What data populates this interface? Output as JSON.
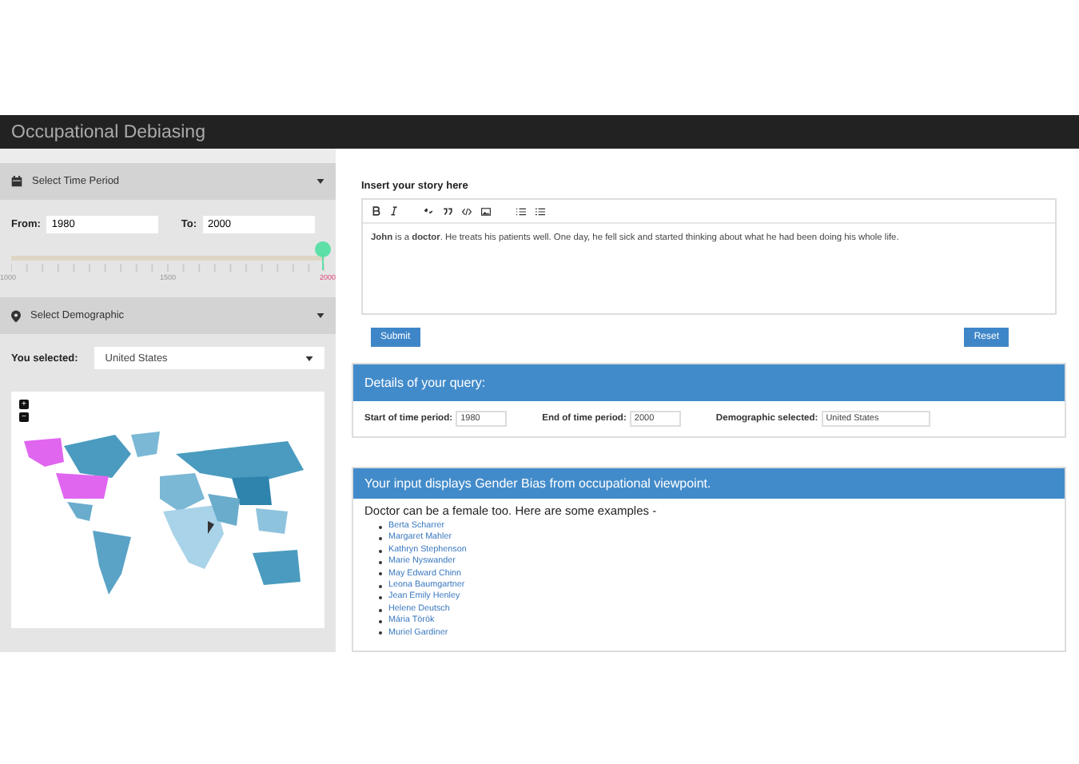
{
  "header": {
    "title": "Occupational Debiasing"
  },
  "sidebar": {
    "time_period": {
      "title": "Select Time Period",
      "from_label": "From:",
      "from_value": "1980",
      "to_label": "To:",
      "to_value": "2000",
      "slider": {
        "level": 1,
        "tick_labels": [
          {
            "text": "1000",
            "selected": false
          },
          {
            "text": "1500",
            "selected": false
          },
          {
            "text": "2000",
            "selected": true
          }
        ]
      }
    },
    "demographic": {
      "title": "Select Demographic",
      "label": "You selected:",
      "value": "United States"
    },
    "map": {
      "zoom_in": "+",
      "zoom_out": "−"
    }
  },
  "story": {
    "label": "Insert your story here",
    "text": "**John** is a **doctor**. He treats his patients well. One day, he fell sick and started thinking about what he had been doing his whole life.",
    "buttons": [
      "Submit",
      "Reset"
    ]
  },
  "query": {
    "title": "Details of your query:",
    "fields": [
      {
        "label": "Start of time period:",
        "value": "1980"
      },
      {
        "label": "End of time period:",
        "value": "2000"
      },
      {
        "label": "Demographic selected:",
        "value": "United States"
      }
    ]
  },
  "result": {
    "title": "Your input displays Gender Bias from occupational viewpoint.",
    "intro": "Doctor can be a female too. Here are some examples -",
    "examples": [
      "Berta Scharrer",
      "Margaret Mahler",
      "Kathryn Stephenson",
      "Marie Nyswander",
      "May Edward Chinn",
      "Leona Baumgartner",
      "Jean Emily Henley",
      "Helene Deutsch",
      "Mária Török",
      "Muriel Gardiner"
    ]
  }
}
